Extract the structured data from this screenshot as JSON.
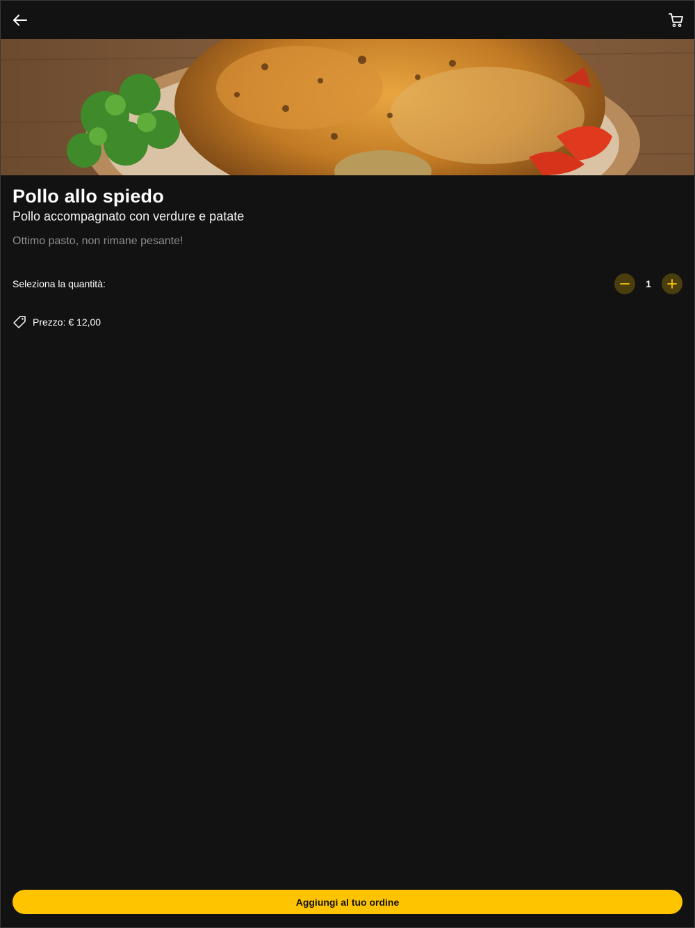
{
  "header": {
    "back_icon": "arrow-left-icon",
    "cart_icon": "cart-icon"
  },
  "product": {
    "name": "Pollo allo spiedo",
    "subtitle": "Pollo accompagnato con verdure e patate",
    "description": "Ottimo pasto, non rimane pesante!"
  },
  "quantity": {
    "label": "Seleziona la quantità:",
    "value": "1",
    "decrement_icon": "minus-icon",
    "increment_icon": "plus-icon"
  },
  "price": {
    "icon": "price-tag-icon",
    "text": "Prezzo: € 12,00"
  },
  "cta": {
    "label": "Aggiungi al tuo ordine"
  },
  "colors": {
    "background": "#121212",
    "accent": "#ffc400",
    "stepper_bg": "#4a3d0e",
    "muted_text": "#8c8c8c"
  }
}
